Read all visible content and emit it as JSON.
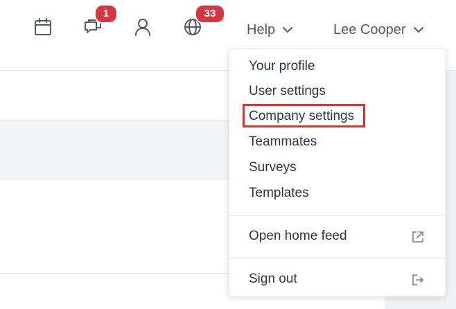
{
  "topbar": {
    "icons": {
      "calendar": "calendar-icon",
      "messages": "messages-icon",
      "user": "user-icon",
      "globe": "globe-icon"
    },
    "messages_badge": "1",
    "globe_badge": "33",
    "help_label": "Help",
    "user_label": "Lee Cooper"
  },
  "dropdown": {
    "items": [
      {
        "label": "Your profile"
      },
      {
        "label": "User settings"
      },
      {
        "label": "Company settings",
        "highlighted": true
      },
      {
        "label": "Teammates"
      },
      {
        "label": "Surveys"
      },
      {
        "label": "Templates"
      }
    ],
    "home_feed_label": "Open home feed",
    "home_feed_icon": "external-link-icon",
    "sign_out_label": "Sign out",
    "sign_out_icon": "sign-out-icon"
  },
  "colors": {
    "badge": "#d63641",
    "highlight": "#e3322b",
    "icon": "#525866"
  }
}
